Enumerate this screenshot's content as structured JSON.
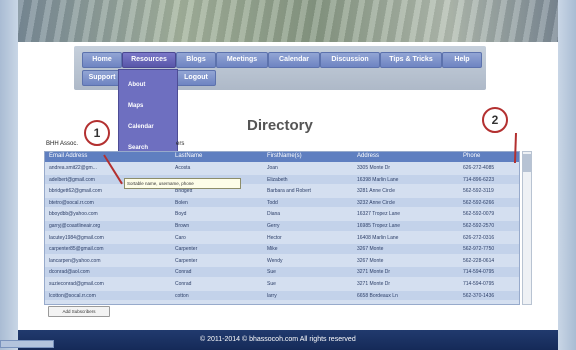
{
  "nav": {
    "tabs": [
      "Home",
      "Resources",
      "Blogs",
      "Meetings",
      "Calendar",
      "Discussion",
      "Tips & Tricks",
      "Help",
      "Support",
      "Logout"
    ]
  },
  "dropdown": {
    "items": [
      "About",
      "Maps",
      "Calendar",
      "Search"
    ]
  },
  "page": {
    "title": "Directory",
    "sublabel_left": "BHH Assoc.",
    "sublabel_right": "ers"
  },
  "table": {
    "columns": [
      "Email Address",
      "LastName",
      "FirstName(s)",
      "Address",
      "Phone"
    ],
    "rows": [
      [
        "andrea.smit22@gm...",
        "Acosta",
        "Joan",
        "3305 Monte Dr",
        "626-272-4085"
      ],
      [
        "adelbert@gmail.com",
        "",
        "Elizabeth",
        "16398 Marlin Lane",
        "714-896-6223"
      ],
      [
        "bbridgett62@gmail.com",
        "Bridgett",
        "Barbara and Robert",
        "3281 Anne Circle",
        "562-592-3119"
      ],
      [
        "btetro@socal.rr.com",
        "Bolen",
        "Todd",
        "3232 Anne Circle",
        "562-592-6266"
      ],
      [
        "bboydbb@yahoo.com",
        "Boyd",
        "Diana",
        "16327 Tropez Lane",
        "562-592-0079"
      ],
      [
        "garryj@coastlineair.org",
        "Brown",
        "Gerry",
        "16985 Tropez Lane",
        "562-592-2570"
      ],
      [
        "lacutey1984@gmail.com",
        "Caro",
        "Hector",
        "16408 Marlin Lane",
        "626-272-0316"
      ],
      [
        "carpenter85@gmail.com",
        "Carpenter",
        "Mike",
        "3267 Monte",
        "562-972-7750"
      ],
      [
        "lancarpen@yahoo.com",
        "Carpenter",
        "Wendy",
        "3267 Monte",
        "562-228-0614"
      ],
      [
        "dconrad@aol.com",
        "Conrad",
        "Sue",
        "3271 Monte Dr",
        "714-594-0795"
      ],
      [
        "suzieconrad@gmail.com",
        "Conrad",
        "Sue",
        "3271 Monte Dr",
        "714-594-0795"
      ],
      [
        "lcotton@socal.rr.com",
        "cotton",
        "larry",
        "6658 Bordeaux Ln",
        "562-370-1436"
      ]
    ]
  },
  "tooltip": {
    "text": "Sortable name, username, phone"
  },
  "add_button": {
    "label": "Add Subscribers"
  },
  "footer": {
    "text": "© 2011-2014 © bhassocoh.com All rights reserved"
  },
  "callouts": [
    "1",
    "2"
  ],
  "colors": {
    "nav_tab": "#7a8fcb",
    "header": "#5f7fc0",
    "footer": "#1a2f5f",
    "callout_ring": "#b33030"
  }
}
